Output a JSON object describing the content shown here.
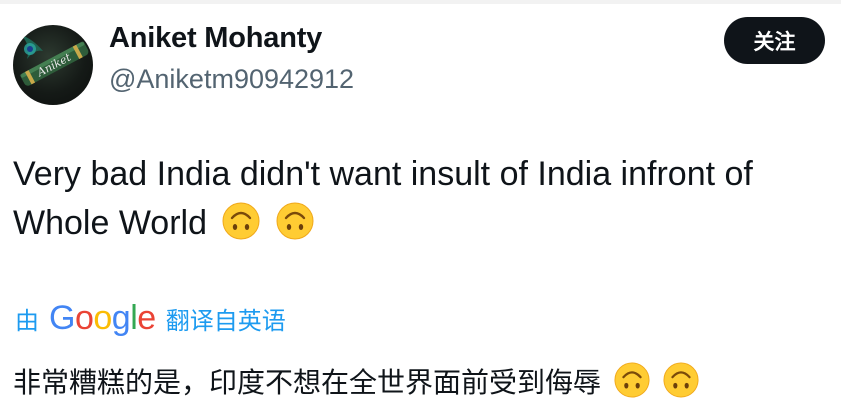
{
  "author": {
    "display_name": "Aniket Mohanty",
    "handle": "@Aniketm90942912",
    "avatar_text": "Aniket"
  },
  "follow_button": {
    "label": "关注"
  },
  "tweet": {
    "text": "Very bad India didn't want insult of India infront of Whole World",
    "emojis": [
      "upside-down-face-emoji",
      "upside-down-face-emoji"
    ]
  },
  "translate": {
    "prefix": "由",
    "provider": "Google",
    "suffix": "翻译自英语"
  },
  "translation": {
    "text": "非常糟糕的是，印度不想在全世界面前受到侮辱"
  },
  "colors": {
    "text": "#0f1419",
    "secondary": "#536471",
    "link": "#1d9bf0",
    "button": "#0f1419",
    "emoji": "#ffcc33"
  }
}
